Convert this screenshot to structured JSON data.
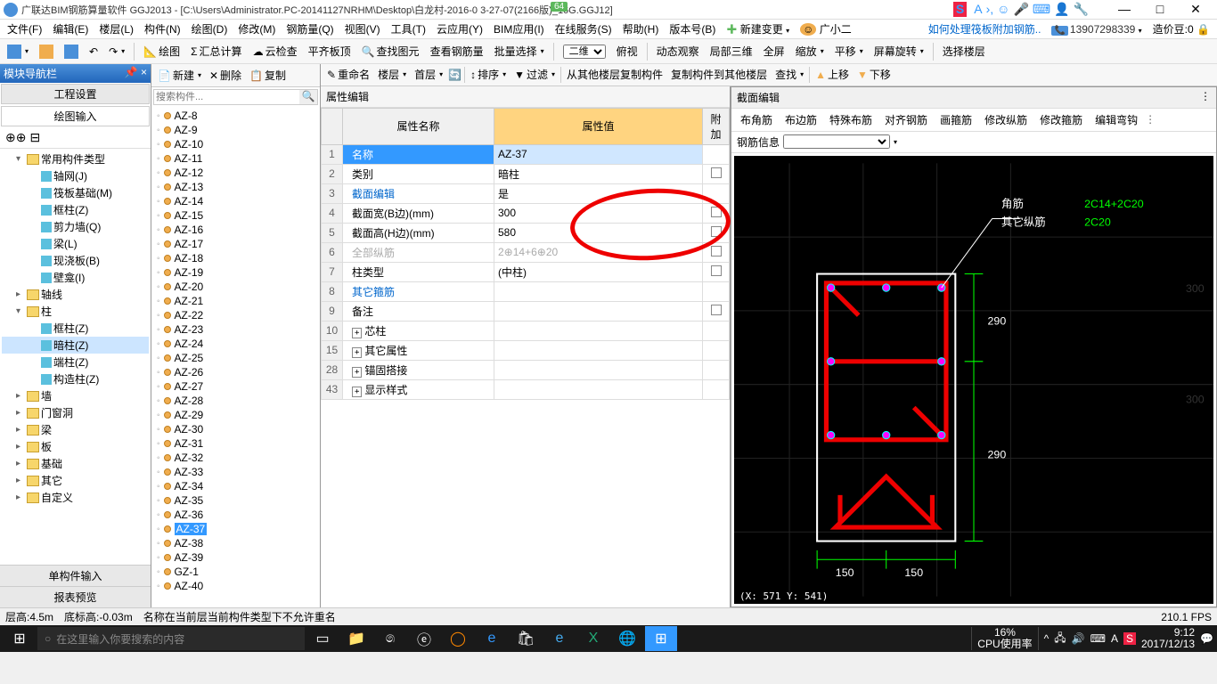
{
  "title": "广联达BIM钢筋算量软件 GGJ2013 - [C:\\Users\\Administrator.PC-20141127NRHM\\Desktop\\白龙村-2016-0     3-27-07(2166版)_16G.GGJ12]",
  "badge_num": "64",
  "menu": [
    "文件(F)",
    "编辑(E)",
    "楼层(L)",
    "构件(N)",
    "绘图(D)",
    "修改(M)",
    "钢筋量(Q)",
    "视图(V)",
    "工具(T)",
    "云应用(Y)",
    "BIM应用(I)",
    "在线服务(S)",
    "帮助(H)",
    "版本号(B)"
  ],
  "menu_right": {
    "new": "新建变更",
    "user": "广小二",
    "help_link": "如何处理筏板附加钢筋..",
    "phone": "13907298339",
    "credit_label": "造价豆:",
    "credit": "0"
  },
  "toolbar1": {
    "draw": "绘图",
    "sum": "汇总计算",
    "cloud": "云检查",
    "level": "平齐板顶",
    "find": "查找图元",
    "view_rebar": "查看钢筋量",
    "batch": "批量选择",
    "view2d": "二维",
    "top": "俯视",
    "dyn": "动态观察",
    "local3d": "局部三维",
    "full": "全屏",
    "zoom": "缩放",
    "pan": "平移",
    "rot": "屏幕旋转",
    "sel_floor": "选择楼层"
  },
  "toolbar2": {
    "new": "新建",
    "del": "删除",
    "copy": "复制",
    "rename": "重命名",
    "floor": "楼层",
    "first": "首层",
    "sort": "排序",
    "filter": "过滤",
    "copy_from": "从其他楼层复制构件",
    "copy_to": "复制构件到其他楼层",
    "search": "查找",
    "up": "上移",
    "down": "下移"
  },
  "nav": {
    "header": "模块导航栏",
    "tab1": "工程设置",
    "tab2": "绘图输入",
    "tree": [
      {
        "t": "常用构件类型",
        "lvl": 1,
        "exp": "-"
      },
      {
        "t": "轴网(J)",
        "lvl": 2,
        "ico": "c"
      },
      {
        "t": "筏板基础(M)",
        "lvl": 2,
        "ico": "c"
      },
      {
        "t": "框柱(Z)",
        "lvl": 2,
        "ico": "c"
      },
      {
        "t": "剪力墙(Q)",
        "lvl": 2,
        "ico": "c"
      },
      {
        "t": "梁(L)",
        "lvl": 2,
        "ico": "c"
      },
      {
        "t": "现浇板(B)",
        "lvl": 2,
        "ico": "c"
      },
      {
        "t": "壁龛(I)",
        "lvl": 2,
        "ico": "c"
      },
      {
        "t": "轴线",
        "lvl": 1,
        "exp": "+"
      },
      {
        "t": "柱",
        "lvl": 1,
        "exp": "-"
      },
      {
        "t": "框柱(Z)",
        "lvl": 2,
        "ico": "c"
      },
      {
        "t": "暗柱(Z)",
        "lvl": 2,
        "ico": "c",
        "sel": true
      },
      {
        "t": "端柱(Z)",
        "lvl": 2,
        "ico": "c"
      },
      {
        "t": "构造柱(Z)",
        "lvl": 2,
        "ico": "c"
      },
      {
        "t": "墙",
        "lvl": 1,
        "exp": "+"
      },
      {
        "t": "门窗洞",
        "lvl": 1,
        "exp": "+"
      },
      {
        "t": "梁",
        "lvl": 1,
        "exp": "+"
      },
      {
        "t": "板",
        "lvl": 1,
        "exp": "+"
      },
      {
        "t": "基础",
        "lvl": 1,
        "exp": "+"
      },
      {
        "t": "其它",
        "lvl": 1,
        "exp": "+"
      },
      {
        "t": "自定义",
        "lvl": 1,
        "exp": "+"
      }
    ],
    "bottom1": "单构件输入",
    "bottom2": "报表预览"
  },
  "search_ph": "搜索构件...",
  "comp_items": [
    "AZ-8",
    "AZ-9",
    "AZ-10",
    "AZ-11",
    "AZ-12",
    "AZ-13",
    "AZ-14",
    "AZ-15",
    "AZ-16",
    "AZ-17",
    "AZ-18",
    "AZ-19",
    "AZ-20",
    "AZ-21",
    "AZ-22",
    "AZ-23",
    "AZ-24",
    "AZ-25",
    "AZ-26",
    "AZ-27",
    "AZ-28",
    "AZ-29",
    "AZ-30",
    "AZ-31",
    "AZ-32",
    "AZ-33",
    "AZ-34",
    "AZ-35",
    "AZ-36",
    "AZ-37",
    "AZ-38",
    "AZ-39",
    "GZ-1",
    "AZ-40"
  ],
  "comp_sel": "AZ-37",
  "prop": {
    "title": "属性编辑",
    "h_name": "属性名称",
    "h_val": "属性值",
    "h_add": "附加",
    "rows": [
      {
        "n": "1",
        "name": "名称",
        "val": "AZ-37",
        "sel": true
      },
      {
        "n": "2",
        "name": "类别",
        "val": "暗柱",
        "ck": true
      },
      {
        "n": "3",
        "name": "截面编辑",
        "val": "是",
        "link": true
      },
      {
        "n": "4",
        "name": "截面宽(B边)(mm)",
        "val": "300",
        "ck": true
      },
      {
        "n": "5",
        "name": "截面高(H边)(mm)",
        "val": "580",
        "ck": true
      },
      {
        "n": "6",
        "name": "全部纵筋",
        "val": "2⊕14+6⊕20",
        "dim": true,
        "ck": true
      },
      {
        "n": "7",
        "name": "柱类型",
        "val": "(中柱)",
        "ck": true
      },
      {
        "n": "8",
        "name": "其它箍筋",
        "val": "",
        "link": true
      },
      {
        "n": "9",
        "name": "备注",
        "val": "",
        "ck": true
      },
      {
        "n": "10",
        "name": "芯柱",
        "val": "",
        "exp": "+"
      },
      {
        "n": "15",
        "name": "其它属性",
        "val": "",
        "exp": "+"
      },
      {
        "n": "28",
        "name": "锚固搭接",
        "val": "",
        "exp": "+"
      },
      {
        "n": "43",
        "name": "显示样式",
        "val": "",
        "exp": "+"
      }
    ]
  },
  "section": {
    "title": "截面编辑",
    "tabs": [
      "布角筋",
      "布边筋",
      "特殊布筋",
      "对齐钢筋",
      "画箍筋",
      "修改纵筋",
      "修改箍筋",
      "编辑弯钩"
    ],
    "bar_label": "钢筋信息",
    "labels": {
      "corner": "角筋",
      "other": "其它纵筋",
      "cval": "2C14+2C20",
      "oval": "2C20"
    },
    "dims": {
      "top": "290",
      "bot": "290",
      "l": "150",
      "r": "150"
    },
    "coord": "(X: 571 Y: 541)"
  },
  "status": {
    "h": "层高:4.5m",
    "b": "底标高:-0.03m",
    "msg": "名称在当前层当前构件类型下不允许重名",
    "fps": "210.1 FPS"
  },
  "taskbar": {
    "search": "在这里输入你要搜索的内容",
    "cpu_pct": "16%",
    "cpu_lbl": "CPU使用率",
    "time": "9:12",
    "date": "2017/12/13"
  }
}
